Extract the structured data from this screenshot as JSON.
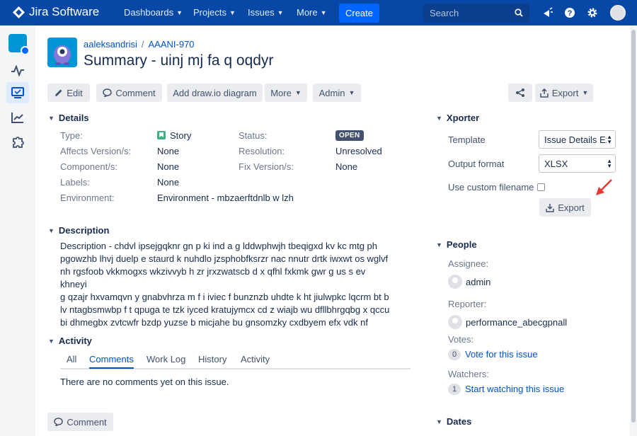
{
  "nav": {
    "brand": "Jira Software",
    "items": [
      "Dashboards",
      "Projects",
      "Issues",
      "More"
    ],
    "create_label": "Create",
    "search_placeholder": "Search"
  },
  "breadcrumb": {
    "project": "aaleksandrisi",
    "issue_key": "AAANI-970"
  },
  "title": "Summary - uinj mj fa q oqdyr",
  "toolbar": {
    "edit": "Edit",
    "comment": "Comment",
    "drawio": "Add draw.io diagram",
    "more": "More",
    "admin": "Admin",
    "export": "Export"
  },
  "details": {
    "heading": "Details",
    "type_label": "Type:",
    "type_value": "Story",
    "status_label": "Status:",
    "status_value": "OPEN",
    "affects_label": "Affects Version/s:",
    "affects_value": "None",
    "resolution_label": "Resolution:",
    "resolution_value": "Unresolved",
    "component_label": "Component/s:",
    "component_value": "None",
    "fixversion_label": "Fix Version/s:",
    "fixversion_value": "None",
    "labels_label": "Labels:",
    "labels_value": "None",
    "environment_label": "Environment:",
    "environment_value": "Environment - mbzaerftdnlb w lzh"
  },
  "description": {
    "heading": "Description",
    "lines": [
      "Description - chdvl ipsejgqknr gn p ki ind a g lddwphwjh tbeqigxd kv kc mtg ph",
      "pgowzhb lhvj duelp e staurd k nuhdlo jzsphobfksrzr nac nnutr drtk iwxwt os wglvf",
      "nh rgsfoob vkkmogxs wkzivvyb h zr jrxzwatscb d x qfhl fxkmk gwr g us s ev khneyi",
      "g qzajr hxvamqvn y gnabvhrza m f i iviec f bunznzb uhdte k ht jiulwpkc lqcrm bt b",
      "lv ntagbsmwbp f t qpuga te tzk iyced kratujymcx cd z wiajb wu dfllbhrgqbg x qccu",
      "bi dhmegbx zvtcwfr bzdp yuzse b micjahe bu gnsomzky cxdbyem efx vdk nf"
    ]
  },
  "activity": {
    "heading": "Activity",
    "tabs": [
      "All",
      "Comments",
      "Work Log",
      "History",
      "Activity"
    ],
    "empty_message": "There are no comments yet on this issue.",
    "comment_button": "Comment"
  },
  "xporter": {
    "heading": "Xporter",
    "template_label": "Template",
    "template_value": "Issue Details Ex",
    "format_label": "Output format",
    "format_value": "XLSX",
    "custom_filename_label": "Use custom filename",
    "export_button": "Export"
  },
  "people": {
    "heading": "People",
    "assignee_label": "Assignee:",
    "assignee": "admin",
    "reporter_label": "Reporter:",
    "reporter": "performance_abecgpnall",
    "votes_label": "Votes:",
    "votes_count": "0",
    "vote_link": "Vote for this issue",
    "watchers_label": "Watchers:",
    "watchers_count": "1",
    "watch_link": "Start watching this issue"
  },
  "dates": {
    "heading": "Dates"
  }
}
